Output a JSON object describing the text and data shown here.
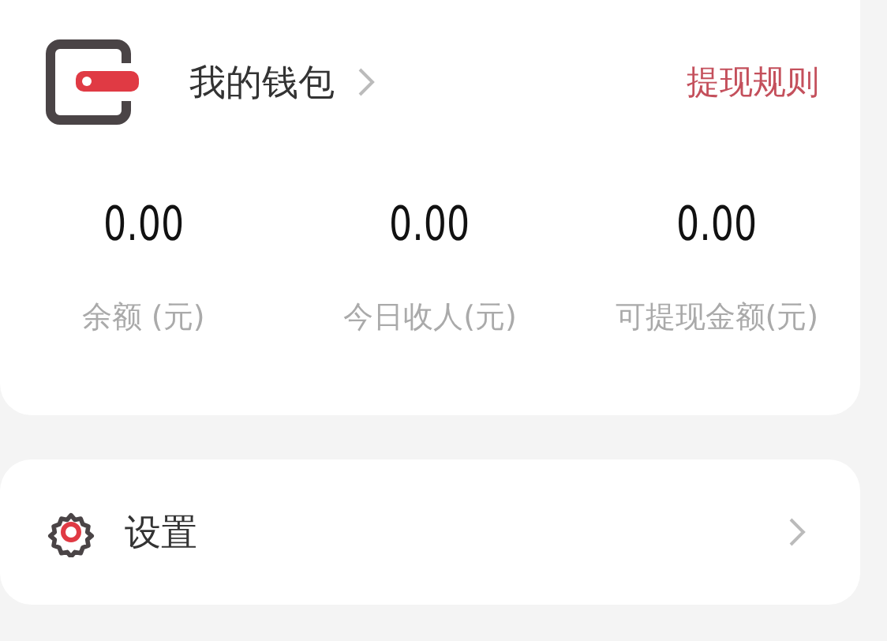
{
  "wallet": {
    "title": "我的钱包",
    "rules_link": "提现规则"
  },
  "stats": [
    {
      "value": "0.00",
      "label": "余额 (元)"
    },
    {
      "value": "0.00",
      "label": "今日收人(元)"
    },
    {
      "value": "0.00",
      "label": "可提现金额(元)"
    }
  ],
  "menu": [
    {
      "kind": "settings",
      "label": "设置"
    }
  ]
}
